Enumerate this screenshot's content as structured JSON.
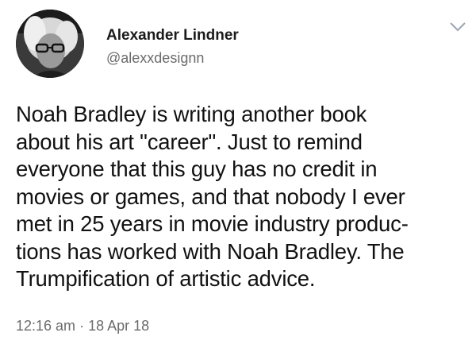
{
  "user": {
    "name": "Alexander Lindner",
    "handle": "@alexxdesignn",
    "avatar_icon": "profile-photo"
  },
  "menu": {
    "icon": "chevron-down-icon"
  },
  "tweet": {
    "text": "Noah Bradley is writing another book\nabout his art \"career\". Just to remind\neveryone that this guy has no credit in\nmovies or games, and that nobody I ever\nmet in 25 years in movie industry produc-\ntions has worked with Noah Bradley. The\nTrumpification of artistic advice."
  },
  "meta": {
    "time": "12:16 am",
    "separator": "·",
    "date": "18 Apr 18"
  },
  "colors": {
    "text": "#111111",
    "muted": "#6b6b6b",
    "background": "#ffffff"
  }
}
